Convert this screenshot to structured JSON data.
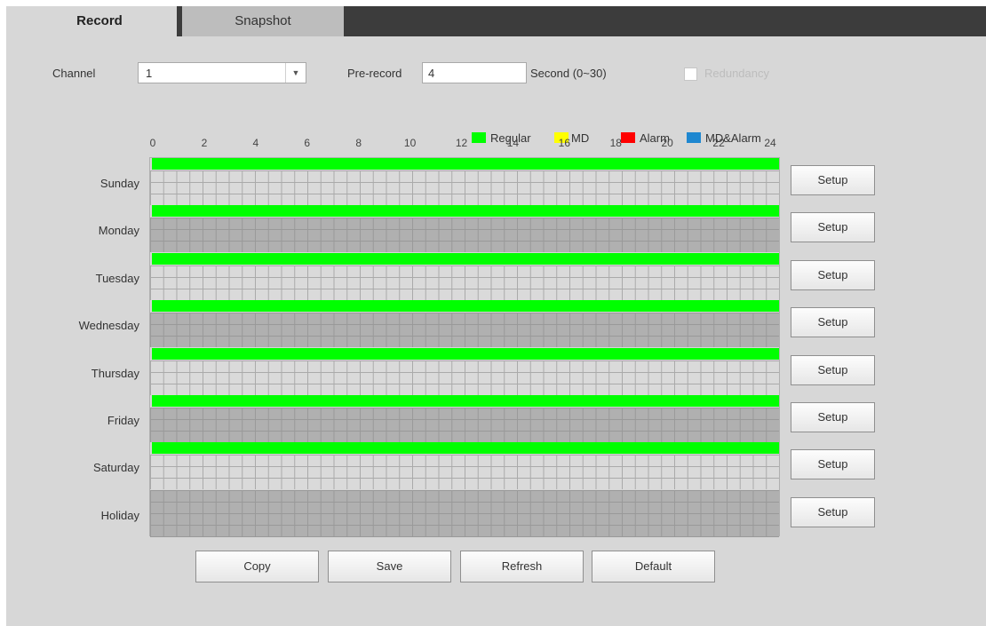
{
  "tabs": [
    {
      "label": "Record",
      "active": true
    },
    {
      "label": "Snapshot",
      "active": false
    }
  ],
  "channel": {
    "label": "Channel",
    "value": "1"
  },
  "prerecord": {
    "label": "Pre-record",
    "value": "4",
    "suffix": "Second (0~30)"
  },
  "redundancy": {
    "label": "Redundancy",
    "checked": false,
    "enabled": false
  },
  "legend": [
    {
      "label": "Regular",
      "color": "#00ff00"
    },
    {
      "label": "MD",
      "color": "#ffff00"
    },
    {
      "label": "Alarm",
      "color": "#ff0000"
    },
    {
      "label": "MD&Alarm",
      "color": "#1e87d0"
    }
  ],
  "hours": [
    "0",
    "2",
    "4",
    "6",
    "8",
    "10",
    "12",
    "14",
    "16",
    "18",
    "20",
    "22",
    "24"
  ],
  "days": [
    {
      "label": "Sunday",
      "regular": true
    },
    {
      "label": "Monday",
      "regular": true
    },
    {
      "label": "Tuesday",
      "regular": true
    },
    {
      "label": "Wednesday",
      "regular": true
    },
    {
      "label": "Thursday",
      "regular": true
    },
    {
      "label": "Friday",
      "regular": true
    },
    {
      "label": "Saturday",
      "regular": true
    },
    {
      "label": "Holiday",
      "regular": false
    }
  ],
  "setup_label": "Setup",
  "buttons": {
    "copy": "Copy",
    "save": "Save",
    "refresh": "Refresh",
    "default": "Default"
  }
}
